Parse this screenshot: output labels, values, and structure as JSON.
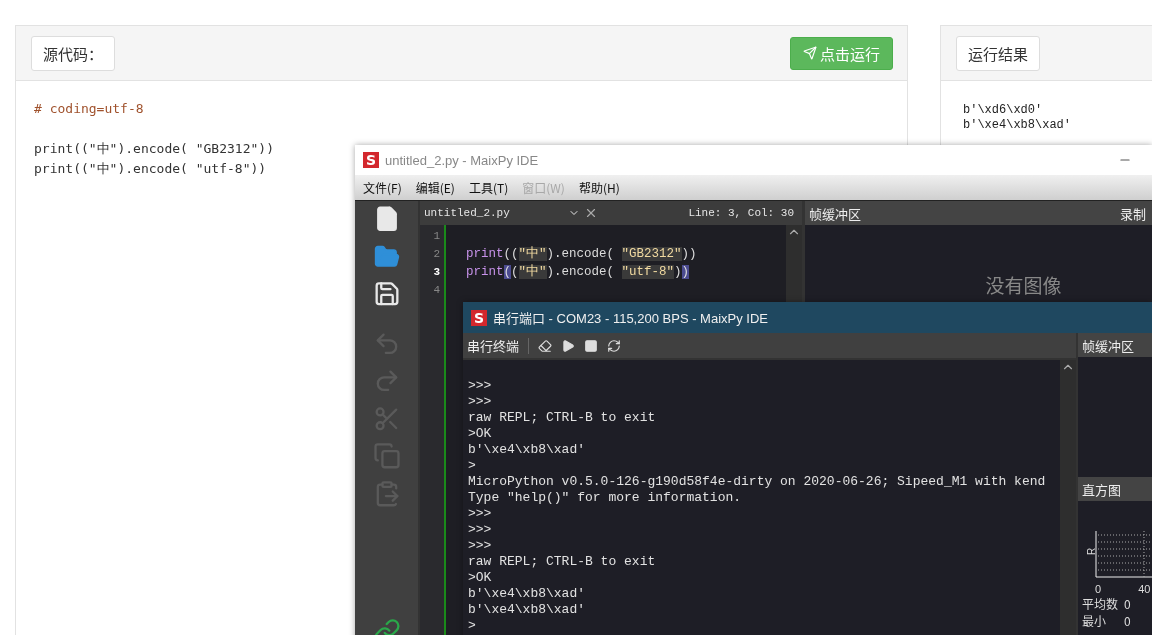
{
  "source_panel": {
    "label": "源代码：",
    "run_button": "点击运行",
    "lines": [
      {
        "kind": "comment",
        "text": "# coding=utf-8"
      },
      {
        "kind": "blank"
      },
      {
        "kind": "code",
        "text": "print((\"中\").encode( \"GB2312\"))"
      },
      {
        "kind": "code",
        "text": "print((\"中\").encode( \"utf-8\"))"
      }
    ]
  },
  "result_panel": {
    "label": "运行结果",
    "lines": [
      "b'\\xd6\\xd0'",
      "b'\\xe4\\xb8\\xad'"
    ]
  },
  "ide_window": {
    "logo": "S",
    "title": "untitled_2.py - MaixPy IDE",
    "menu": [
      {
        "label": "文件(F)",
        "disabled": false
      },
      {
        "label": "编辑(E)",
        "disabled": false
      },
      {
        "label": "工具(T)",
        "disabled": false
      },
      {
        "label": "窗口(W)",
        "disabled": true
      },
      {
        "label": "帮助(H)",
        "disabled": false
      }
    ],
    "toolbar": [
      {
        "kind": "new",
        "disabled": false
      },
      {
        "kind": "open",
        "disabled": false
      },
      {
        "kind": "save",
        "disabled": false
      },
      {
        "kind": "undo",
        "disabled": true
      },
      {
        "kind": "redo",
        "disabled": true
      },
      {
        "kind": "cut",
        "disabled": true
      },
      {
        "kind": "copy",
        "disabled": true
      },
      {
        "kind": "paste",
        "disabled": true
      },
      {
        "kind": "connect",
        "disabled": false
      }
    ],
    "editor": {
      "file": "untitled_2.py",
      "position": "Line: 3, Col: 30",
      "lines": [
        {
          "number": "1",
          "current": false
        },
        {
          "number": "2",
          "current": false,
          "segments": [
            {
              "kind": "func",
              "text": "print"
            },
            {
              "kind": "punct",
              "text": "(("
            },
            {
              "kind": "string",
              "text": "\"中\""
            },
            {
              "kind": "punct",
              "text": ").encode( "
            },
            {
              "kind": "string",
              "text": "\"GB2312\""
            },
            {
              "kind": "punct",
              "text": "))"
            }
          ]
        },
        {
          "number": "3",
          "current": true,
          "segments": [
            {
              "kind": "func",
              "text": "print"
            },
            {
              "kind": "match",
              "text": "("
            },
            {
              "kind": "punct",
              "text": "("
            },
            {
              "kind": "string",
              "text": "\"中\""
            },
            {
              "kind": "punct",
              "text": ").encode( "
            },
            {
              "kind": "string",
              "text": "\"utf-8\""
            },
            {
              "kind": "punct",
              "text": ")"
            },
            {
              "kind": "match",
              "text": ")"
            }
          ]
        },
        {
          "number": "4",
          "current": false
        }
      ]
    },
    "frame_buffer": {
      "title": "帧缓冲区",
      "record": "录制",
      "empty": "没有图像"
    }
  },
  "serial_window": {
    "logo": "S",
    "title": "串行端口 - COM23 - 115,200 BPS - MaixPy IDE",
    "toolbar_label": "串行终端",
    "tools": [
      {
        "kind": "clear"
      },
      {
        "kind": "play"
      },
      {
        "kind": "stop"
      },
      {
        "kind": "refresh"
      }
    ],
    "lines": [
      ">>>",
      ">>>",
      "raw REPL; CTRL-B to exit",
      ">OK",
      "b'\\xe4\\xb8\\xad'",
      ">",
      "MicroPython v0.5.0-126-g190d58f4e-dirty on 2020-06-26; Sipeed_M1 with kend",
      "Type \"help()\" for more information.",
      ">>>",
      ">>>",
      ">>>",
      "raw REPL; CTRL-B to exit",
      ">OK",
      "b'\\xe4\\xb8\\xad'",
      "b'\\xe4\\xb8\\xad'",
      ">"
    ],
    "frame_buffer": {
      "title": "帧缓冲区"
    },
    "histogram": {
      "title": "直方图",
      "channel": "R",
      "ticks": [
        "0",
        "40"
      ],
      "stats": [
        {
          "label": "平均数",
          "value": "0"
        },
        {
          "label": "最小",
          "value": "0"
        }
      ]
    }
  }
}
